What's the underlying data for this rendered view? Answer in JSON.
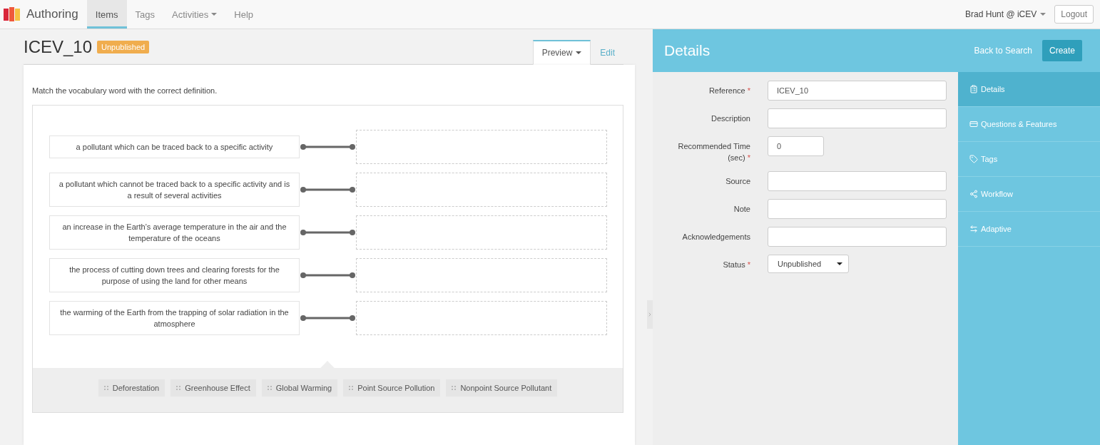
{
  "nav": {
    "brand": "Authoring",
    "items": [
      {
        "label": "Items",
        "selected": true,
        "dropdown": false
      },
      {
        "label": "Tags",
        "selected": false,
        "dropdown": false
      },
      {
        "label": "Activities",
        "selected": false,
        "dropdown": true
      },
      {
        "label": "Help",
        "selected": false,
        "dropdown": false
      }
    ],
    "user": "Brad Hunt @ iCEV",
    "logout": "Logout"
  },
  "item": {
    "title": "ICEV_10",
    "status": "Unpublished",
    "view_tabs": [
      {
        "label": "Preview",
        "selected": true,
        "dropdown": true
      },
      {
        "label": "Edit",
        "selected": false,
        "dropdown": false
      }
    ],
    "prompt": "Match the vocabulary word with the correct definition.",
    "stems": [
      "a pollutant which can be traced back to a specific activity",
      "a pollutant which cannot be traced back to a specific activity and is a result of several activities",
      "an increase in the Earth’s average temperature in the air and the temperature of the oceans",
      "the process of cutting down trees and clearing forests for the purpose of using the land for other means",
      "the warming of the Earth from the trapping of solar radiation in the atmosphere"
    ],
    "choices": [
      "Deforestation",
      "Greenhouse Effect",
      "Global Warming",
      "Point Source Pollution",
      "Nonpoint Source Pollutant"
    ]
  },
  "details": {
    "title": "Details",
    "required_mark": "*",
    "back": "Back to Search",
    "create": "Create",
    "fields": [
      {
        "label": "Reference",
        "required": true,
        "kind": "text",
        "value": "ICEV_10"
      },
      {
        "label": "Description",
        "required": false,
        "kind": "text"
      },
      {
        "label": "Recommended Time (sec)",
        "required": true,
        "kind": "short",
        "value": "0"
      },
      {
        "label": "Source",
        "required": false,
        "kind": "text"
      },
      {
        "label": "Note",
        "required": false,
        "kind": "text"
      },
      {
        "label": "Acknowledgements",
        "required": false,
        "kind": "text"
      },
      {
        "label": "Status",
        "required": true,
        "kind": "select",
        "value": "Unpublished"
      }
    ],
    "side_nav": [
      {
        "label": "Details",
        "selected": true
      },
      {
        "label": "Questions & Features",
        "selected": false
      },
      {
        "label": "Tags",
        "selected": false
      },
      {
        "label": "Workflow",
        "selected": false
      },
      {
        "label": "Adaptive",
        "selected": false
      }
    ]
  }
}
